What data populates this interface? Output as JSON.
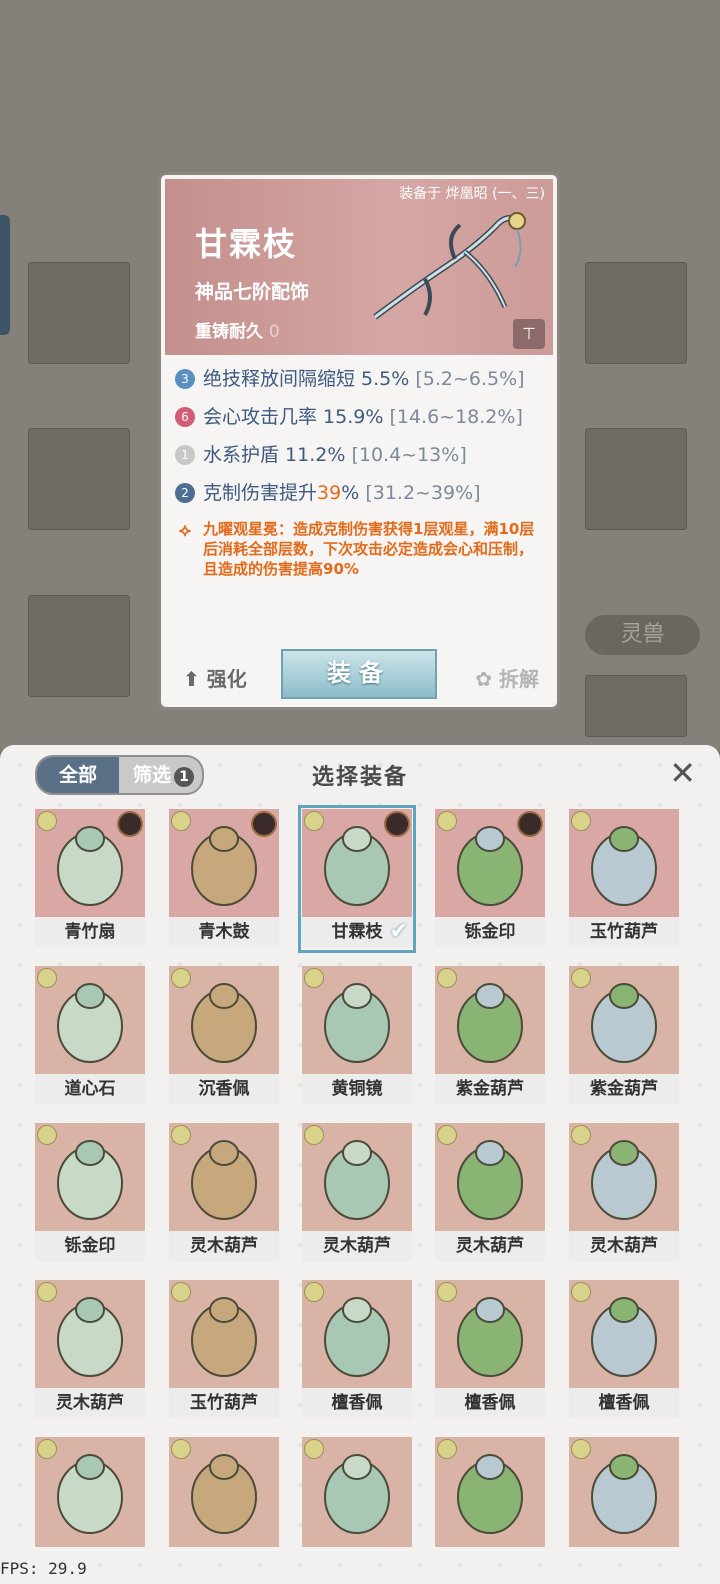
{
  "background": {
    "side_tab_label": "灵兽"
  },
  "detail": {
    "equipped_on": "装备于 烨凰昭 (一、三)",
    "name": "甘霖枝",
    "grade": "神品七阶配饰",
    "durability_label": "重铸耐久",
    "durability_value": "0",
    "lock_icon": "lock-icon",
    "stats": [
      {
        "badge": "3",
        "badge_color": "#5a8fc4",
        "text": "绝技释放间隔缩短 5.5%",
        "range": "[5.2~6.5%]"
      },
      {
        "badge": "6",
        "badge_color": "#d25b78",
        "text": "会心攻击几率 15.9%",
        "range": "[14.6~18.2%]"
      },
      {
        "badge": "1",
        "badge_color": "#c7c7c7",
        "text": "水系护盾 11.2%",
        "range": "[10.4~13%]"
      },
      {
        "badge": "2",
        "badge_color": "#4d6f93",
        "text_pre": "克制伤害提升",
        "text_hl": "39",
        "text_post": "%",
        "range": "[31.2~39%]"
      }
    ],
    "skill": "九曜观星冕：造成克制伤害获得1层观星，满10层后消耗全部层数，下次攻击必定造成会心和压制，且造成的伤害提高90%",
    "actions": {
      "upgrade": "强化",
      "equip": "装备",
      "dismantle": "拆解"
    }
  },
  "panel": {
    "tab_all": "全部",
    "tab_filter": "筛选",
    "filter_count": "1",
    "title": "选择装备",
    "close_icon": "close-icon",
    "items": [
      {
        "name": "青竹扇",
        "avatar": true,
        "lock": false,
        "selected": false
      },
      {
        "name": "青木鼓",
        "avatar": true,
        "lock": true,
        "selected": false
      },
      {
        "name": "甘霖枝",
        "avatar": true,
        "lock": true,
        "selected": true
      },
      {
        "name": "铄金印",
        "avatar": true,
        "lock": true,
        "selected": false
      },
      {
        "name": "玉竹葫芦",
        "avatar": false,
        "lock": false,
        "selected": false
      },
      {
        "name": "道心石",
        "avatar": false,
        "lock": true,
        "selected": false
      },
      {
        "name": "沉香佩",
        "avatar": false,
        "lock": false,
        "selected": false
      },
      {
        "name": "黄铜镜",
        "avatar": false,
        "lock": false,
        "selected": false
      },
      {
        "name": "紫金葫芦",
        "avatar": false,
        "lock": false,
        "selected": false
      },
      {
        "name": "紫金葫芦",
        "avatar": false,
        "lock": false,
        "selected": false
      },
      {
        "name": "铄金印",
        "avatar": false,
        "lock": true,
        "selected": false
      },
      {
        "name": "灵木葫芦",
        "avatar": false,
        "lock": true,
        "selected": false
      },
      {
        "name": "灵木葫芦",
        "avatar": false,
        "lock": false,
        "selected": false
      },
      {
        "name": "灵木葫芦",
        "avatar": false,
        "lock": false,
        "selected": false
      },
      {
        "name": "灵木葫芦",
        "avatar": false,
        "lock": false,
        "selected": false
      },
      {
        "name": "灵木葫芦",
        "avatar": false,
        "lock": false,
        "selected": false
      },
      {
        "name": "玉竹葫芦",
        "avatar": false,
        "lock": false,
        "selected": false
      },
      {
        "name": "檀香佩",
        "avatar": false,
        "lock": false,
        "selected": false
      },
      {
        "name": "檀香佩",
        "avatar": false,
        "lock": false,
        "selected": false
      },
      {
        "name": "檀香佩",
        "avatar": false,
        "lock": false,
        "selected": false
      },
      {
        "name": "",
        "avatar": false,
        "lock": false,
        "selected": false
      },
      {
        "name": "",
        "avatar": false,
        "lock": false,
        "selected": false
      },
      {
        "name": "",
        "avatar": false,
        "lock": false,
        "selected": false
      },
      {
        "name": "",
        "avatar": false,
        "lock": false,
        "selected": false
      },
      {
        "name": "",
        "avatar": false,
        "lock": false,
        "selected": false
      }
    ]
  },
  "fps": "FPS: 29.9"
}
